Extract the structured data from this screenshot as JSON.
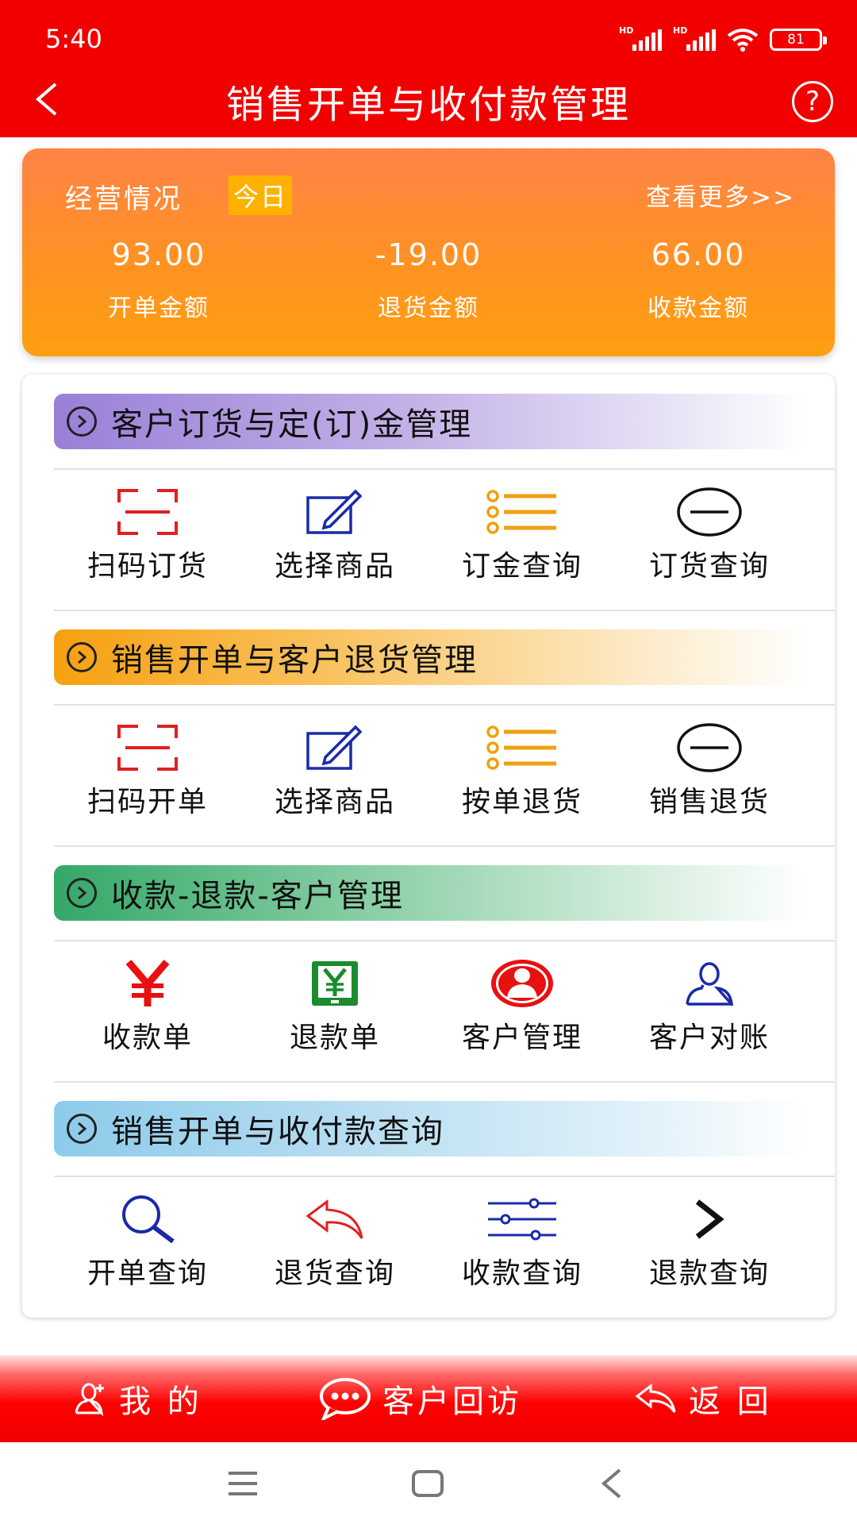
{
  "status": {
    "time": "5:40",
    "battery": "81",
    "signal_label": "HD"
  },
  "header": {
    "title": "销售开单与收付款管理",
    "help_glyph": "?"
  },
  "summary": {
    "label": "经营情况",
    "badge": "今日",
    "more": "查看更多>>",
    "stats": [
      {
        "value": "93.00",
        "label": "开单金额"
      },
      {
        "value": "-19.00",
        "label": "退货金额"
      },
      {
        "value": "66.00",
        "label": "收款金额"
      }
    ]
  },
  "sections": [
    {
      "title": "客户订货与定(订)金管理",
      "items": [
        {
          "label": "扫码订货",
          "icon": "scan-icon"
        },
        {
          "label": "选择商品",
          "icon": "edit-icon"
        },
        {
          "label": "订金查询",
          "icon": "list-icon"
        },
        {
          "label": "订货查询",
          "icon": "minus-circle-icon"
        }
      ]
    },
    {
      "title": "销售开单与客户退货管理",
      "items": [
        {
          "label": "扫码开单",
          "icon": "scan-icon"
        },
        {
          "label": "选择商品",
          "icon": "edit-icon"
        },
        {
          "label": "按单退货",
          "icon": "list-icon"
        },
        {
          "label": "销售退货",
          "icon": "minus-circle-icon"
        }
      ]
    },
    {
      "title": "收款-退款-客户管理",
      "items": [
        {
          "label": "收款单",
          "icon": "yen-icon"
        },
        {
          "label": "退款单",
          "icon": "yen-tablet-icon"
        },
        {
          "label": "客户管理",
          "icon": "user-circle-icon"
        },
        {
          "label": "客户对账",
          "icon": "user-outline-icon"
        }
      ]
    },
    {
      "title": "销售开单与收付款查询",
      "items": [
        {
          "label": "开单查询",
          "icon": "search-icon"
        },
        {
          "label": "退货查询",
          "icon": "reply-icon"
        },
        {
          "label": "收款查询",
          "icon": "sliders-icon"
        },
        {
          "label": "退款查询",
          "icon": "chevron-right-icon"
        }
      ]
    }
  ],
  "bottom_bar": {
    "mine": "我 的",
    "visit": "客户回访",
    "back": "返 回"
  },
  "colors": {
    "brand_red": "#f20000",
    "section1": "#9b7fd9",
    "section2": "#f6a21a",
    "section3": "#3aaa6a",
    "section4": "#8ccbea"
  }
}
